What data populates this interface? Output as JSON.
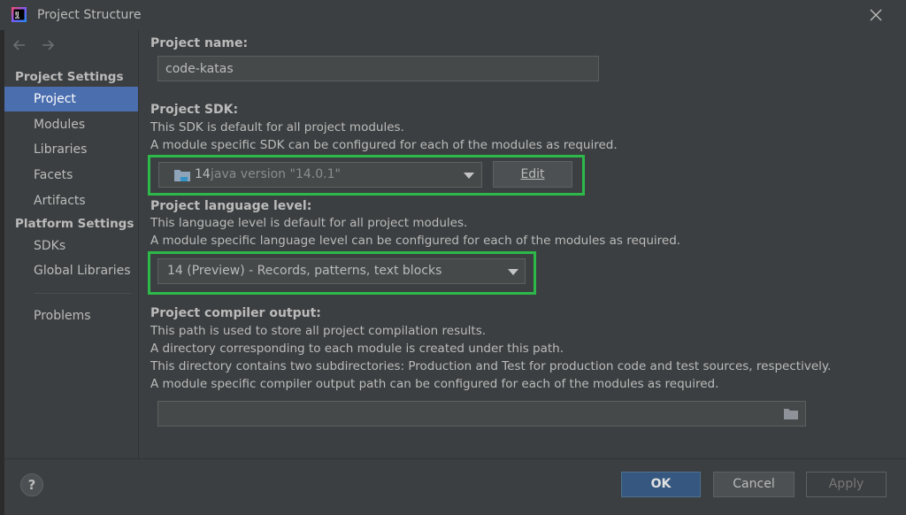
{
  "window": {
    "title": "Project Structure"
  },
  "sidebar": {
    "project_settings_header": "Project Settings",
    "project_settings_items": [
      {
        "label": "Project",
        "selected": true
      },
      {
        "label": "Modules"
      },
      {
        "label": "Libraries"
      },
      {
        "label": "Facets"
      },
      {
        "label": "Artifacts"
      }
    ],
    "platform_settings_header": "Platform Settings",
    "platform_settings_items": [
      {
        "label": "SDKs"
      },
      {
        "label": "Global Libraries"
      }
    ],
    "problems_label": "Problems"
  },
  "content": {
    "project_name": {
      "label": "Project name:",
      "value": "code-katas"
    },
    "project_sdk": {
      "label": "Project SDK:",
      "desc1": "This SDK is default for all project modules.",
      "desc2": "A module specific SDK can be configured for each of the modules as required.",
      "selected_name": "14",
      "selected_version": "java version \"14.0.1\"",
      "edit_label": "Edit"
    },
    "language_level": {
      "label": "Project language level:",
      "desc1": "This language level is default for all project modules.",
      "desc2": "A module specific language level can be configured for each of the modules as required.",
      "selected": "14 (Preview) - Records, patterns, text blocks"
    },
    "compiler_output": {
      "label": "Project compiler output:",
      "desc1": "This path is used to store all project compilation results.",
      "desc2": "A directory corresponding to each module is created under this path.",
      "desc3": "This directory contains two subdirectories: Production and Test for production code and test sources, respectively.",
      "desc4": "A module specific compiler output path can be configured for each of the modules as required.",
      "value": ""
    }
  },
  "footer": {
    "help_label": "?",
    "ok_label": "OK",
    "cancel_label": "Cancel",
    "apply_label": "Apply"
  },
  "colors": {
    "accent_selection": "#4b6eaf",
    "highlight_box": "#2db84a",
    "primary_button": "#365880"
  }
}
